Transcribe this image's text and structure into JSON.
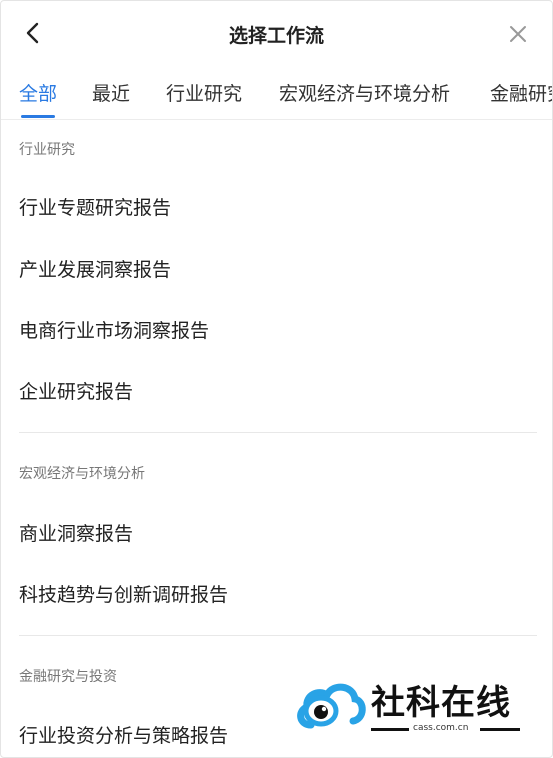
{
  "header": {
    "title": "选择工作流"
  },
  "tabs": [
    {
      "label": "全部",
      "active": true
    },
    {
      "label": "最近"
    },
    {
      "label": "行业研究"
    },
    {
      "label": "宏观经济与环境分析"
    },
    {
      "label": "金融研究"
    }
  ],
  "sections": [
    {
      "title": "行业研究",
      "items": [
        "行业专题研究报告",
        "产业发展洞察报告",
        "电商行业市场洞察报告",
        "企业研究报告"
      ]
    },
    {
      "title": "宏观经济与环境分析",
      "items": [
        "商业洞察报告",
        "科技趋势与创新调研报告"
      ]
    },
    {
      "title": "金融研究与投资",
      "items": [
        "行业投资分析与策略报告"
      ]
    }
  ],
  "watermark": {
    "text": "社科在线",
    "url": "cass.com.cn"
  },
  "colors": {
    "accent": "#2a7ae2",
    "watermark_blue": "#29a3e6"
  }
}
